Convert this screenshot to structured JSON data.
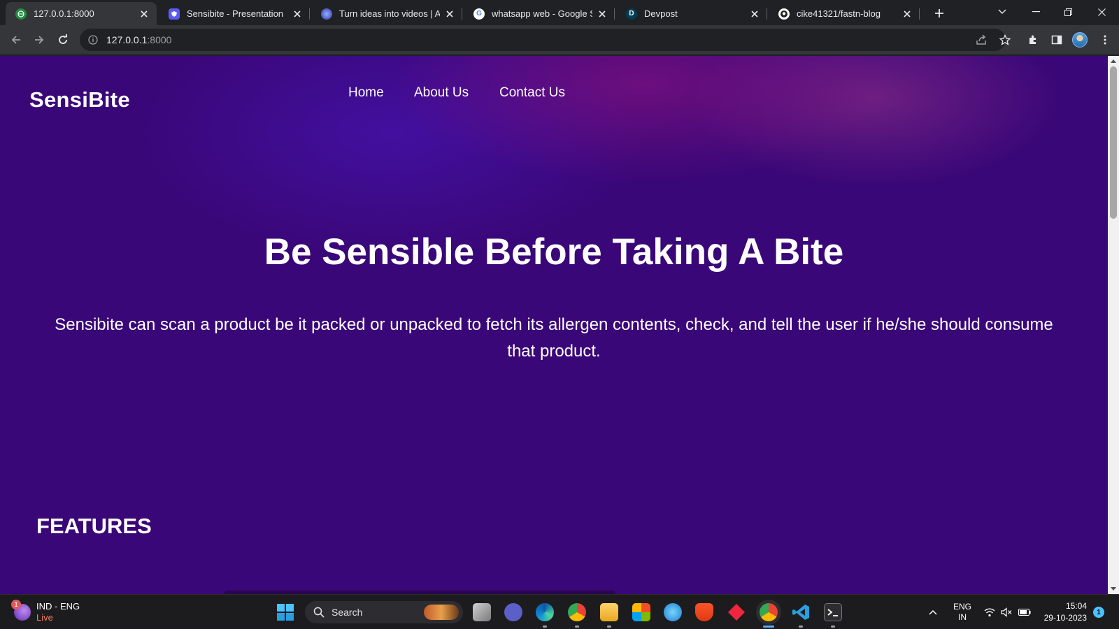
{
  "browser": {
    "tabs": [
      {
        "title": "127.0.0.1:8000",
        "favicon": "globe-icon",
        "active": true
      },
      {
        "title": "Sensibite - Presentation",
        "favicon": "shield-icon",
        "active": false
      },
      {
        "title": "Turn ideas into videos | AI",
        "favicon": "sparkle-icon",
        "active": false
      },
      {
        "title": "whatsapp web - Google Se",
        "favicon": "google-icon",
        "active": false
      },
      {
        "title": "Devpost",
        "favicon": "devpost-icon",
        "active": false
      },
      {
        "title": "cike41321/fastn-blog",
        "favicon": "github-icon",
        "active": false
      }
    ],
    "address": {
      "host": "127.0.0.1",
      "port": ":8000"
    }
  },
  "page": {
    "brand": "SensiBite",
    "nav": [
      "Home",
      "About Us",
      "Contact Us"
    ],
    "hero_title": "Be Sensible Before Taking A Bite",
    "hero_description": "Sensibite can scan a product be it packed or unpacked to fetch its allergen contents, check, and tell the user if he/she should consume that product.",
    "features_heading": "FEATURES"
  },
  "taskbar": {
    "weather_badge": "1",
    "weather_line1": "IND - ENG",
    "weather_line2": "Live",
    "search_label": "Search",
    "language_line1": "ENG",
    "language_line2": "IN",
    "time": "15:04",
    "date": "29-10-2023",
    "notification_count": "1"
  },
  "colors": {
    "page_background": "#3a0778",
    "accent_magenta": "#96148a",
    "taskbar": "#1c1c1f",
    "browser_frame": "#202124"
  }
}
